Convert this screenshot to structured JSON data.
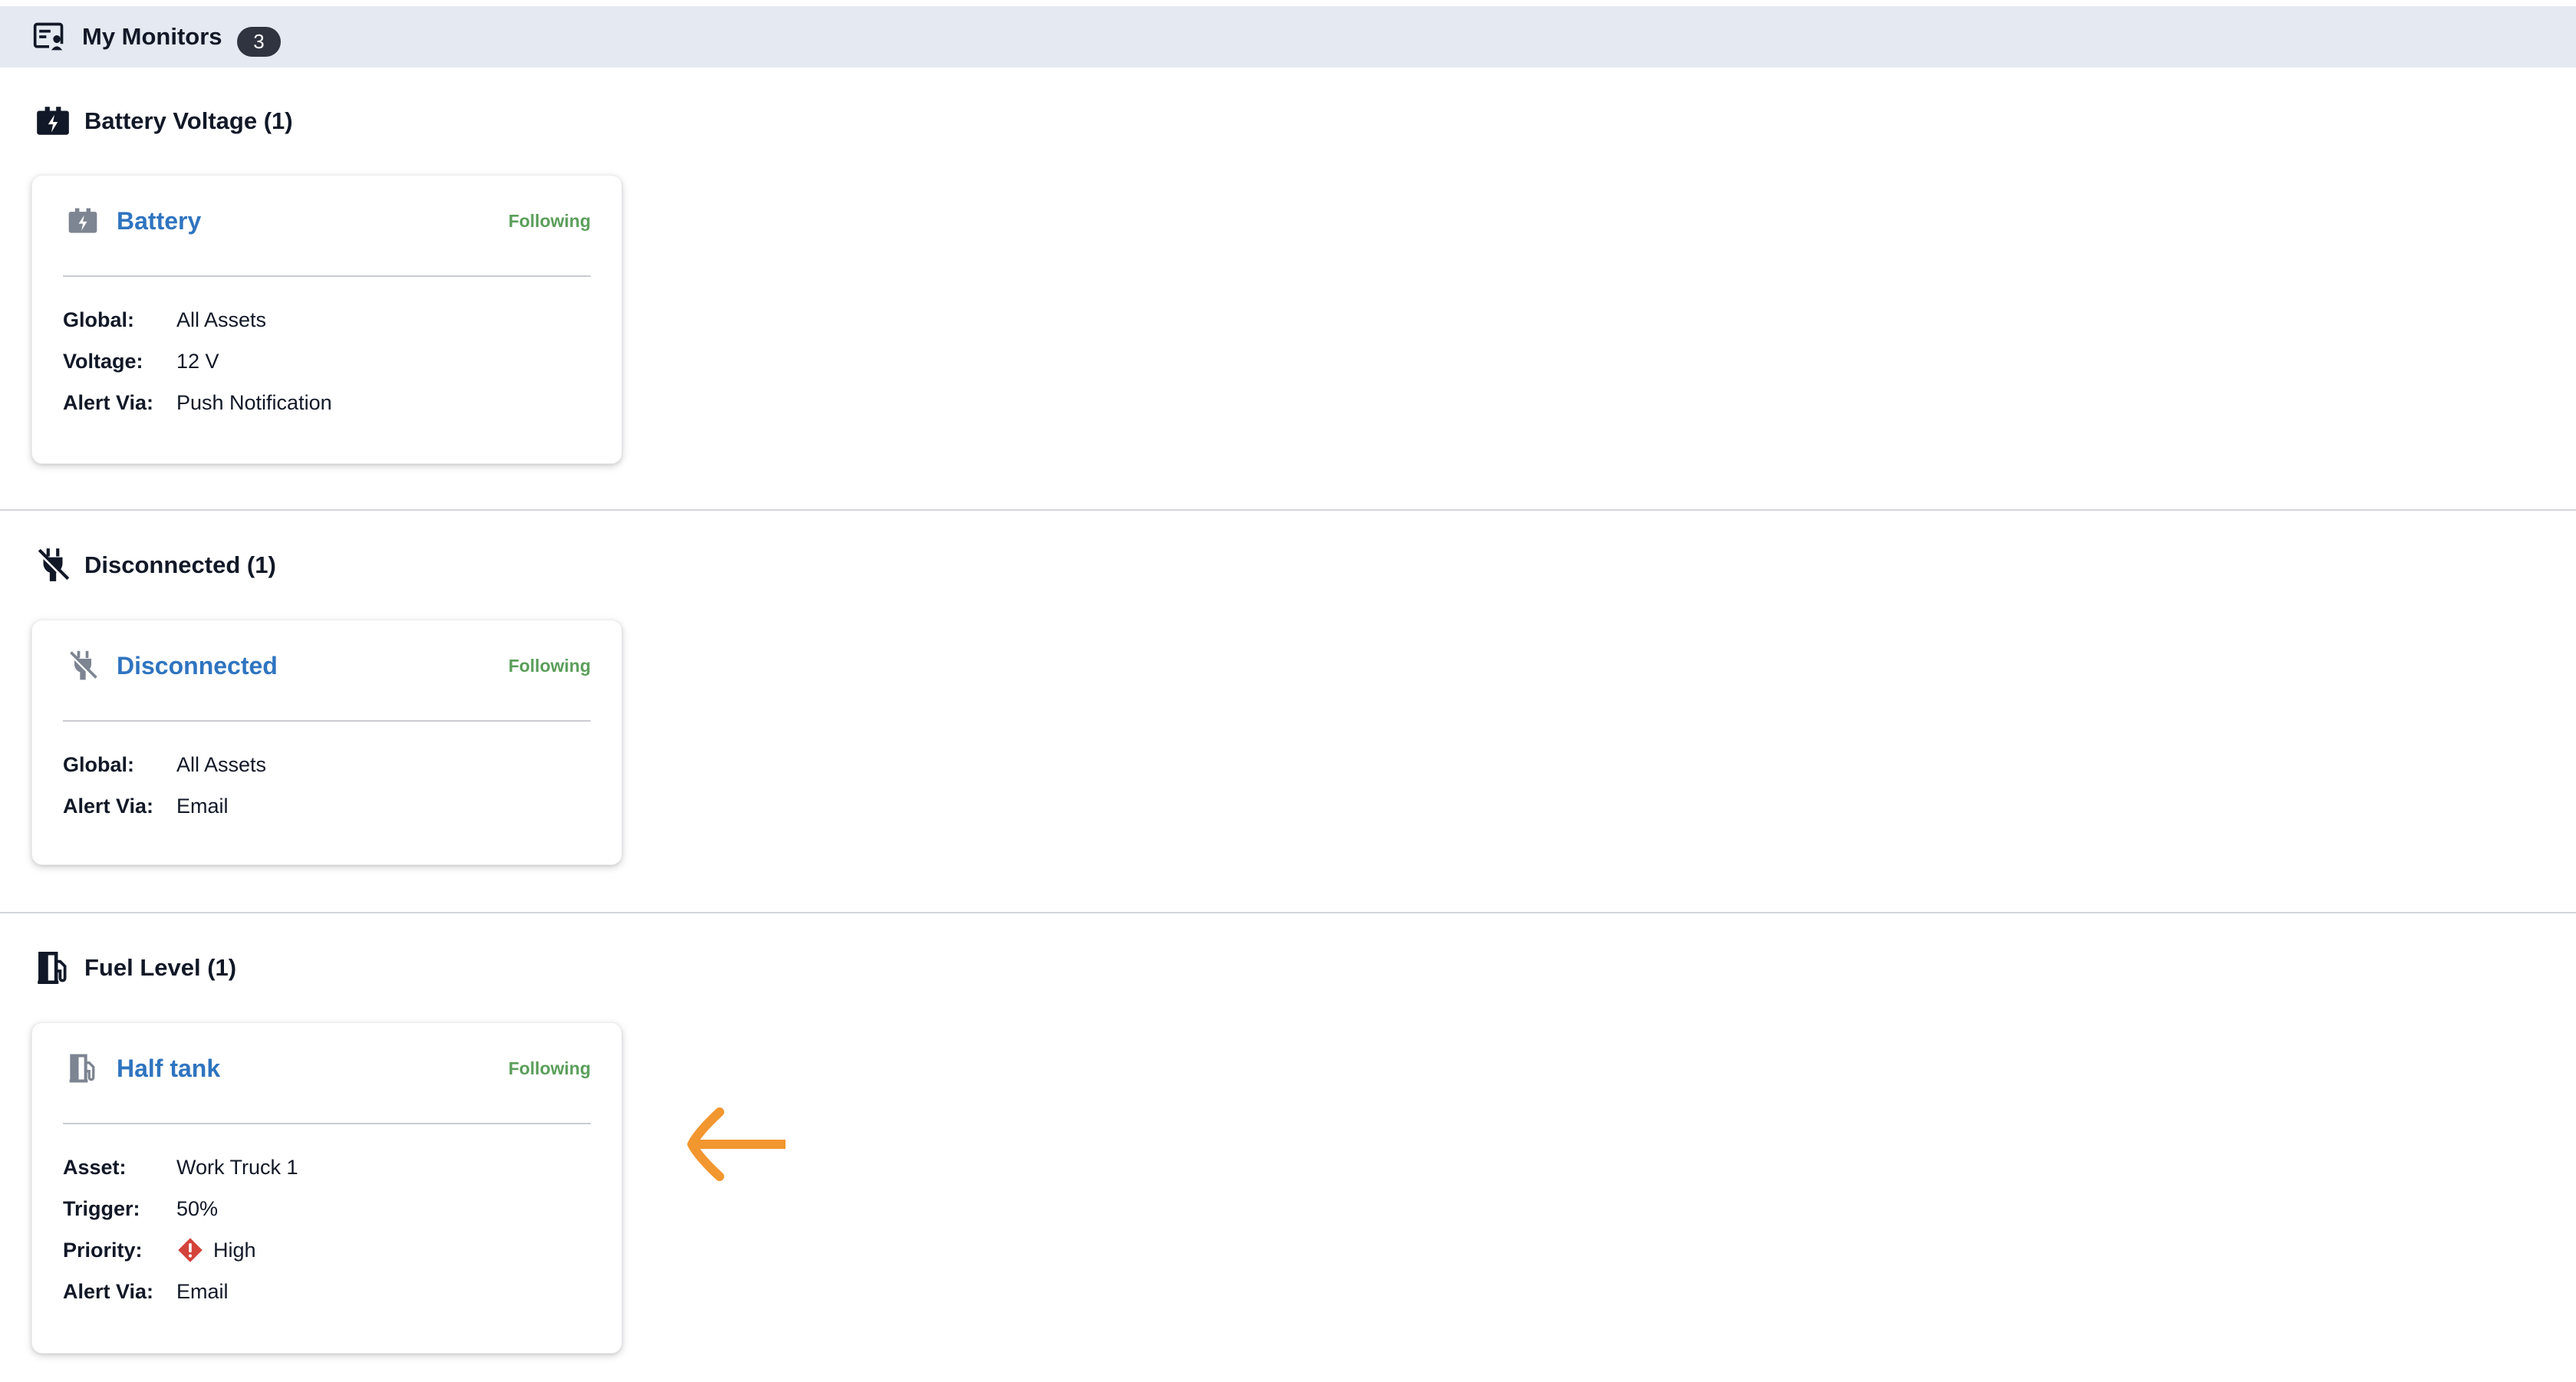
{
  "header": {
    "title": "My Monitors",
    "count": "3",
    "icon": "monitor-list-icon"
  },
  "sections": [
    {
      "label": "Battery Voltage (1)",
      "icon": "battery-icon",
      "card": {
        "title": "Battery",
        "status": "Following",
        "rows": [
          {
            "key": "Global:",
            "value": "All Assets"
          },
          {
            "key": "Voltage:",
            "value": "12 V"
          },
          {
            "key": "Alert Via:",
            "value": "Push Notification"
          }
        ]
      }
    },
    {
      "label": "Disconnected (1)",
      "icon": "unplugged-icon",
      "card": {
        "title": "Disconnected",
        "status": "Following",
        "rows": [
          {
            "key": "Global:",
            "value": "All Assets"
          },
          {
            "key": "Alert Via:",
            "value": "Email"
          }
        ]
      }
    },
    {
      "label": "Fuel Level (1)",
      "icon": "fuel-pump-icon",
      "card": {
        "title": "Half tank",
        "status": "Following",
        "rows": [
          {
            "key": "Asset:",
            "value": "Work Truck 1"
          },
          {
            "key": "Trigger:",
            "value": "50%"
          },
          {
            "key": "Priority:",
            "value": "High",
            "icon": "priority-high-icon"
          },
          {
            "key": "Alert Via:",
            "value": "Email"
          }
        ]
      }
    }
  ],
  "colors": {
    "header_bg": "#e5e9f1",
    "link": "#2f74c0",
    "status": "#5a9e5a",
    "priority_high": "#d3443b",
    "annotation_arrow": "#f2962f"
  },
  "annotation": {
    "icon": "arrow-left-icon"
  }
}
